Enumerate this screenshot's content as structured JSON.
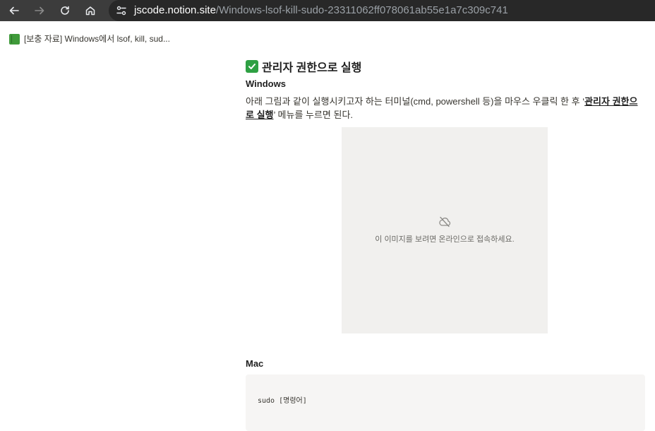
{
  "browser": {
    "url_host": "jscode.notion.site",
    "url_path": "/Windows-lsof-kill-sudo-23311062ff078061ab55e1a7c309c741",
    "icons": [
      "back-icon",
      "forward-icon",
      "reload-icon",
      "home-icon",
      "site-info-icon"
    ]
  },
  "topbar": {
    "breadcrumb": "[보충 자료] Windows에서 lsof, kill, sud..."
  },
  "content": {
    "heading": "관리자 권한으로 실행",
    "windows_heading": "Windows",
    "windows_text_before": "아래 그림과 같이 실행시키고자 하는 터미널(cmd, powershell 등)을 마우스 우클릭 한 후 ‘",
    "windows_text_bold": "관리자 권한으로 실행",
    "windows_text_after": "’ 메뉴를 누르면 된다.",
    "image_offline_message": "이 이미지를 보려면 온라인으로 접속하세요.",
    "mac_heading": "Mac",
    "mac_code": "sudo [명령어]"
  },
  "colors": {
    "chrome_bg": "#3c3c3c",
    "omnibox_bg": "#282828",
    "page_icon": "#3f9a3a",
    "check_icon": "#2ea043",
    "image_placeholder": "#f1f0ee",
    "code_bg": "#f6f5f4"
  }
}
